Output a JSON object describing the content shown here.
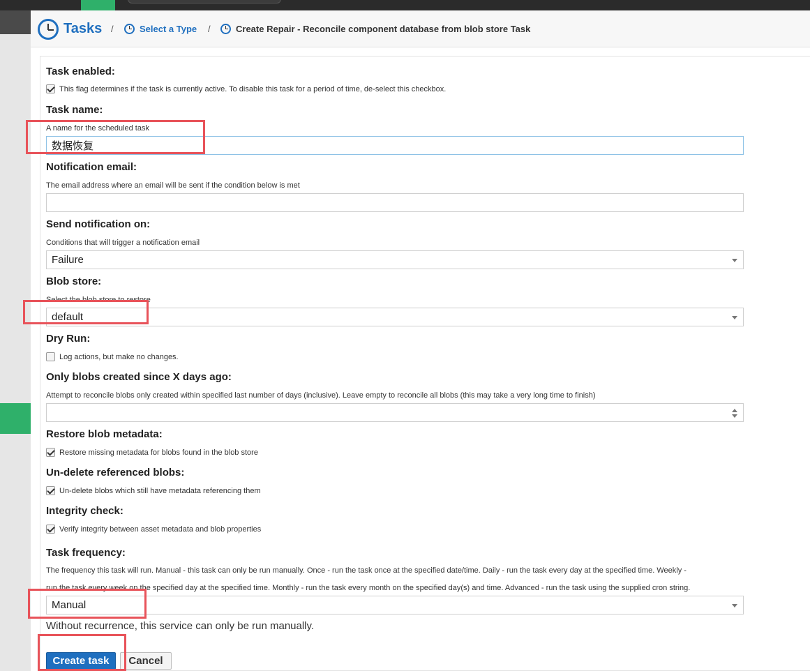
{
  "breadcrumb": {
    "root": "Tasks",
    "separator": "/",
    "step2": "Select a Type",
    "current": "Create Repair - Reconcile component database from blob store Task"
  },
  "form": {
    "task_enabled": {
      "label": "Task enabled:",
      "help": "This flag determines if the task is currently active. To disable this task for a period of time, de-select this checkbox.",
      "checked": true
    },
    "task_name": {
      "label": "Task name:",
      "help": "A name for the scheduled task",
      "value": "数据恢复"
    },
    "notification_email": {
      "label": "Notification email:",
      "help": "The email address where an email will be sent if the condition below is met",
      "value": ""
    },
    "send_notification_on": {
      "label": "Send notification on:",
      "help": "Conditions that will trigger a notification email",
      "value": "Failure"
    },
    "blob_store": {
      "label": "Blob store:",
      "help": "Select the blob store to restore",
      "value": "default"
    },
    "dry_run": {
      "label": "Dry Run:",
      "help": "Log actions, but make no changes.",
      "checked": false
    },
    "since_days": {
      "label": "Only blobs created since X days ago:",
      "help": "Attempt to reconcile blobs only created within specified last number of days (inclusive). Leave empty to reconcile all blobs (this may take a very long time to finish)",
      "value": ""
    },
    "restore_metadata": {
      "label": "Restore blob metadata:",
      "help": "Restore missing metadata for blobs found in the blob store",
      "checked": true
    },
    "undelete": {
      "label": "Un-delete referenced blobs:",
      "help": "Un-delete blobs which still have metadata referencing them",
      "checked": true
    },
    "integrity": {
      "label": "Integrity check:",
      "help": "Verify integrity between asset metadata and blob properties",
      "checked": true
    },
    "frequency": {
      "label": "Task frequency:",
      "help_line1": "The frequency this task will run. Manual - this task can only be run manually. Once - run the task once at the specified date/time. Daily - run the task every day at the specified time. Weekly -",
      "help_line2": "run the task every week on the specified day at the specified time. Monthly - run the task every month on the specified day(s) and time. Advanced - run the task using the supplied cron string.",
      "value": "Manual",
      "note": "Without recurrence, this service can only be run manually."
    }
  },
  "buttons": {
    "create": "Create task",
    "cancel": "Cancel"
  },
  "colors": {
    "accent": "#1f6fbf",
    "nav_active": "#2fb06a",
    "annotation": "#e8535a"
  }
}
